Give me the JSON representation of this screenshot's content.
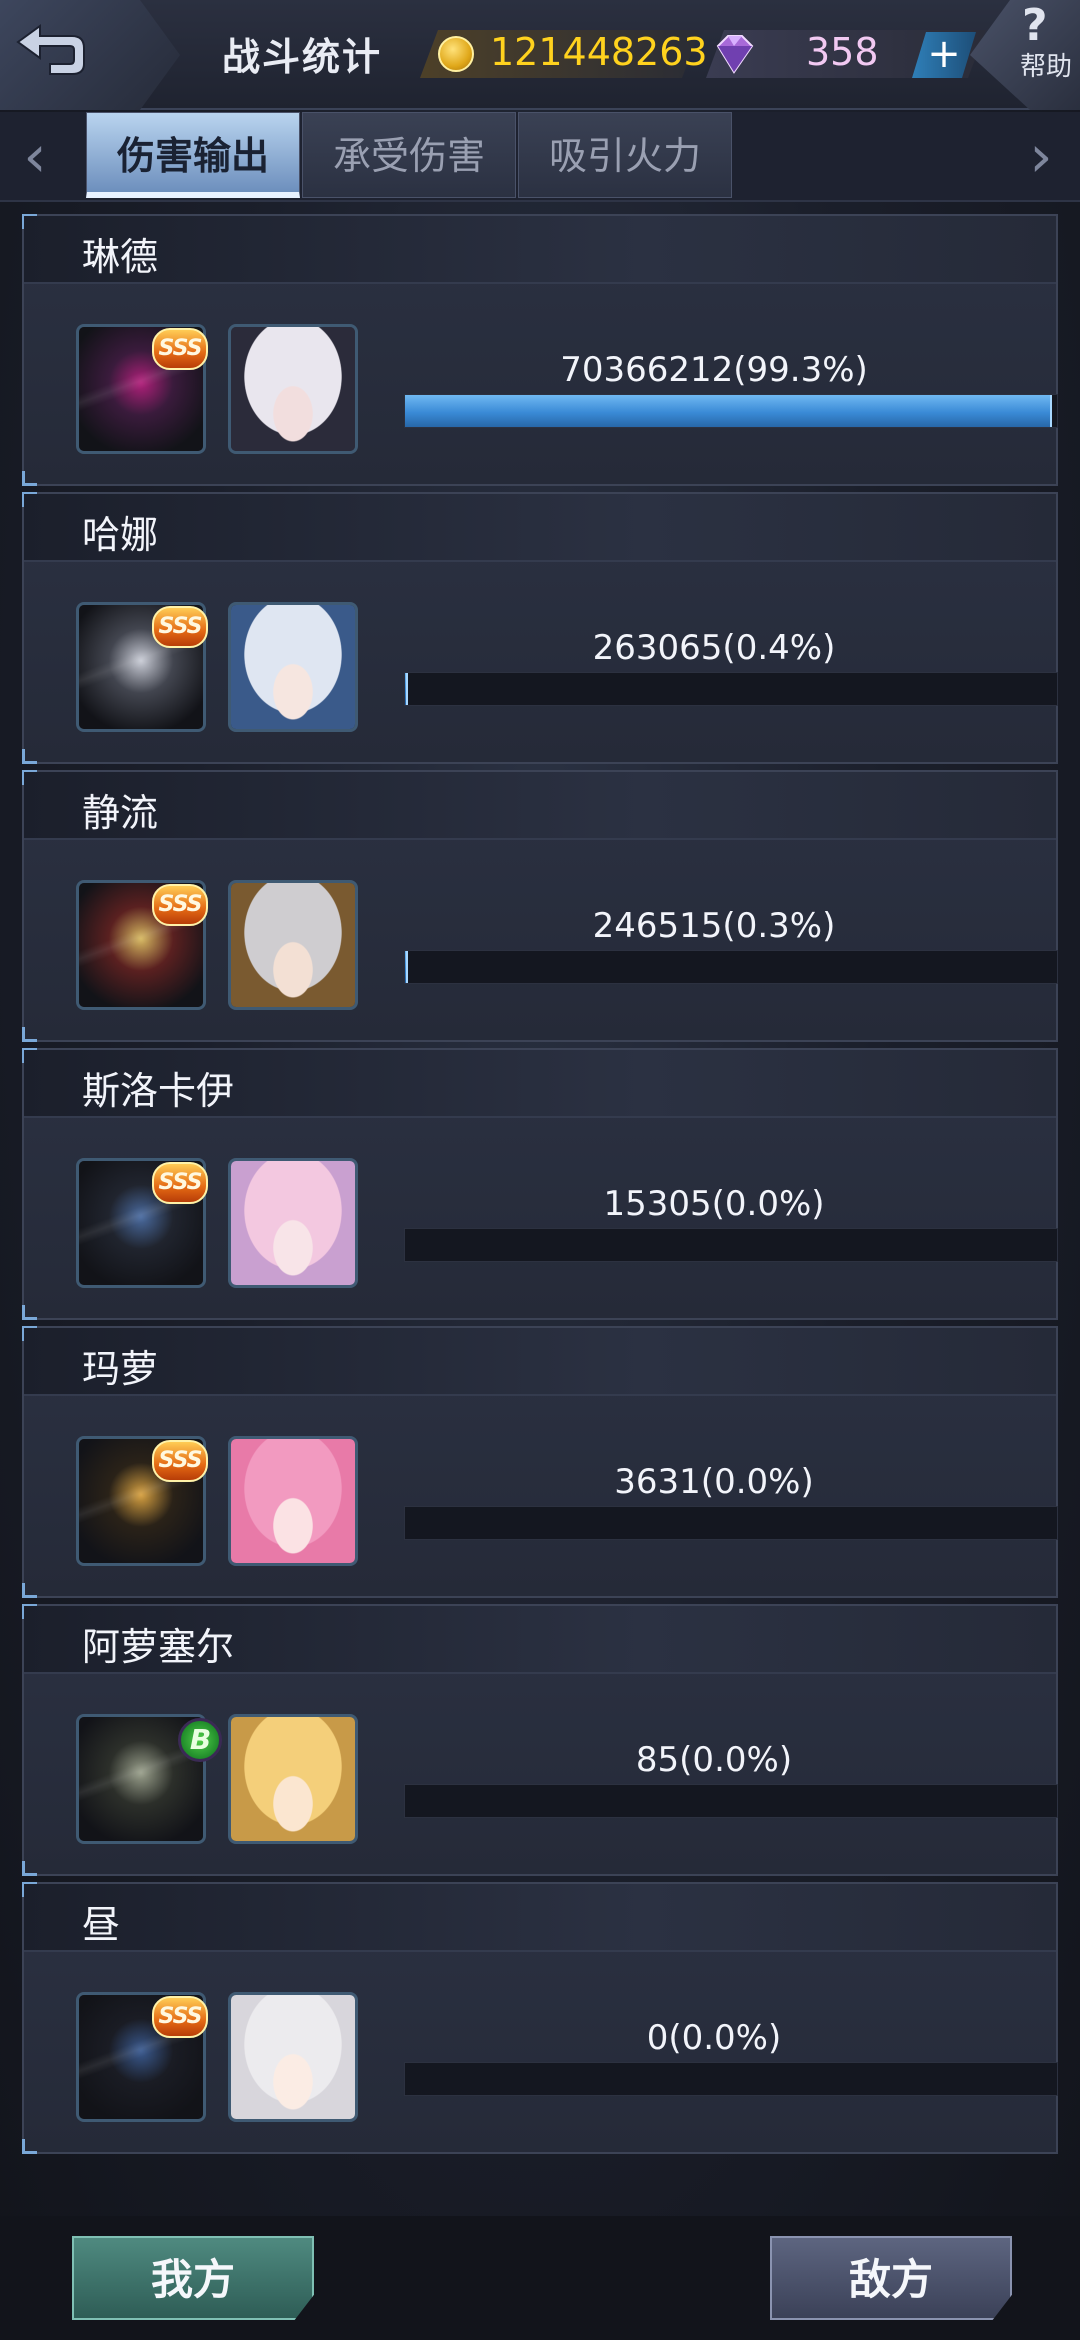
{
  "header": {
    "title": "战斗统计",
    "coins": "121448263",
    "gems": "358",
    "plus_label": "+",
    "help_label": "帮助"
  },
  "tabs": [
    {
      "label": "伤害输出",
      "active": true
    },
    {
      "label": "承受伤害",
      "active": false
    },
    {
      "label": "吸引火力",
      "active": false
    }
  ],
  "nav": {
    "prev_icon": "‹",
    "next_icon": "›"
  },
  "rows": [
    {
      "name": "琳德",
      "value_text": "70366212(99.3%)",
      "fraction": 0.993,
      "rank": "SSS",
      "mech_colors": [
        "#b0207a",
        "#3a1b3c"
      ],
      "girl_colors": {
        "hair": "#e9e6ee",
        "skin": "#f2dede",
        "bg": "#2b2b3a"
      }
    },
    {
      "name": "哈娜",
      "value_text": "263065(0.4%)",
      "fraction": 0.004,
      "rank": "SSS",
      "mech_colors": [
        "#c9ccd6",
        "#42454f"
      ],
      "girl_colors": {
        "hair": "#dfe6f2",
        "skin": "#f6e6e0",
        "bg": "#3a5a8a"
      }
    },
    {
      "name": "静流",
      "value_text": "246515(0.3%)",
      "fraction": 0.003,
      "rank": "SSS",
      "mech_colors": [
        "#d6b860",
        "#5a2020"
      ],
      "girl_colors": {
        "hair": "#cfcdd0",
        "skin": "#f3e0d4",
        "bg": "#7a5a30"
      }
    },
    {
      "name": "斯洛卡伊",
      "value_text": "15305(0.0%)",
      "fraction": 0.0,
      "rank": "SSS",
      "mech_colors": [
        "#4a6ba0",
        "#20242e"
      ],
      "girl_colors": {
        "hair": "#f3c8e0",
        "skin": "#f8e4e8",
        "bg": "#c9a0d0"
      }
    },
    {
      "name": "玛萝",
      "value_text": "3631(0.0%)",
      "fraction": 0.0,
      "rank": "SSS",
      "mech_colors": [
        "#d6a040",
        "#2a2218"
      ],
      "girl_colors": {
        "hair": "#f29ac0",
        "skin": "#fbe2e4",
        "bg": "#e87aa8"
      }
    },
    {
      "name": "阿萝塞尔",
      "value_text": "85(0.0%)",
      "fraction": 0.0,
      "rank": "B",
      "mech_colors": [
        "#9aa08c",
        "#2c2f2a"
      ],
      "girl_colors": {
        "hair": "#f4cf7a",
        "skin": "#fbe6d0",
        "bg": "#c89a48"
      }
    },
    {
      "name": "昼",
      "value_text": "0(0.0%)",
      "fraction": 0.0,
      "rank": "SSS",
      "mech_colors": [
        "#3a5a90",
        "#1a1c24"
      ],
      "girl_colors": {
        "hair": "#ecebee",
        "skin": "#fbece4",
        "bg": "#d8d6dc"
      }
    }
  ],
  "bottom": {
    "ours_label": "我方",
    "enemy_label": "敌方"
  },
  "icons": {
    "back": "back-arrow-icon",
    "coin": "gold-coin-icon",
    "gem": "diamond-icon",
    "help": "question-mark-icon"
  }
}
